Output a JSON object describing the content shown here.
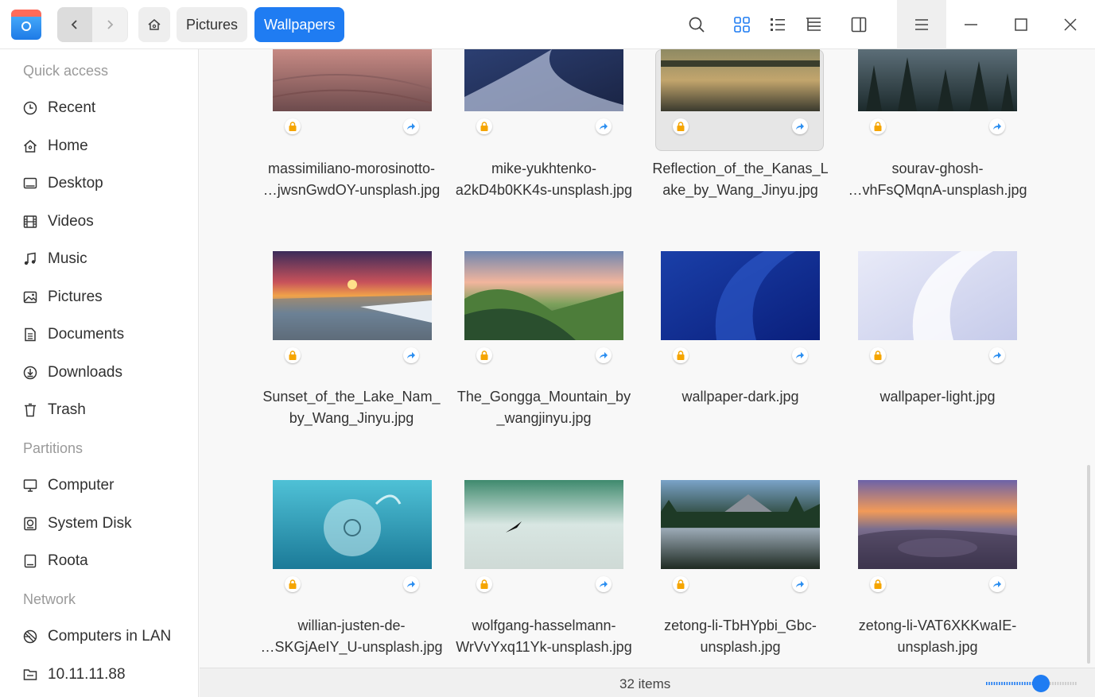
{
  "window": {
    "breadcrumbs": [
      "Pictures",
      "Wallpapers"
    ]
  },
  "sidebar": {
    "groups": [
      {
        "label": "Quick access",
        "items": [
          "Recent",
          "Home",
          "Desktop",
          "Videos",
          "Music",
          "Pictures",
          "Documents",
          "Downloads",
          "Trash"
        ]
      },
      {
        "label": "Partitions",
        "items": [
          "Computer",
          "System Disk",
          "Roota"
        ]
      },
      {
        "label": "Network",
        "items": [
          "Computers in LAN",
          "10.11.11.88"
        ]
      }
    ]
  },
  "files": [
    {
      "line1": "massimiliano-morosinotto-",
      "line2": "…jwsnGwdOY-unsplash.jpg"
    },
    {
      "line1": "mike-yukhtenko-",
      "line2": "a2kD4b0KK4s-unsplash.jpg"
    },
    {
      "line1": "Reflection_of_the_Kanas_L",
      "line2": "ake_by_Wang_Jinyu.jpg"
    },
    {
      "line1": "sourav-ghosh-",
      "line2": "…vhFsQMqnA-unsplash.jpg"
    },
    {
      "line1": "Sunset_of_the_Lake_Nam_",
      "line2": "by_Wang_Jinyu.jpg"
    },
    {
      "line1": "The_Gongga_Mountain_by",
      "line2": "_wangjinyu.jpg"
    },
    {
      "line1": "wallpaper-dark.jpg",
      "line2": ""
    },
    {
      "line1": "wallpaper-light.jpg",
      "line2": ""
    },
    {
      "line1": "willian-justen-de-",
      "line2": "…SKGjAeIY_U-unsplash.jpg"
    },
    {
      "line1": "wolfgang-hasselmann-",
      "line2": "WrVvYxq11Yk-unsplash.jpg"
    },
    {
      "line1": "zetong-li-TbHYpbi_Gbc-",
      "line2": "unsplash.jpg"
    },
    {
      "line1": "zetong-li-VAT6XKKwaIE-",
      "line2": "unsplash.jpg"
    }
  ],
  "status": {
    "item_count": "32 items",
    "zoom_level": 0.6
  },
  "colors": {
    "accent": "#1f7cf2",
    "lock_badge": "#f5a500",
    "share_badge": "#2b8ef0"
  }
}
